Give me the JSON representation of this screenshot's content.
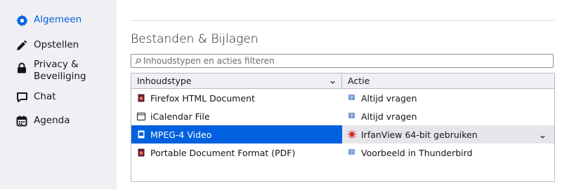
{
  "sidebar": {
    "items": [
      {
        "label": "Algemeen",
        "icon": "gear-icon"
      },
      {
        "label": "Opstellen",
        "icon": "pencil-icon"
      },
      {
        "label": "Privacy & Beveiliging",
        "icon": "lock-icon"
      },
      {
        "label": "Chat",
        "icon": "chat-icon"
      },
      {
        "label": "Agenda",
        "icon": "calendar-icon"
      }
    ]
  },
  "section": {
    "title": "Bestanden & Bijlagen",
    "search_placeholder": "Inhoudstypen en acties filteren"
  },
  "table": {
    "columns": {
      "type": "Inhoudstype",
      "action": "Actie"
    },
    "rows": [
      {
        "type": "Firefox HTML Document",
        "type_icon": "firefox-doc-icon",
        "action": "Altijd vragen",
        "action_icon": "ask-icon"
      },
      {
        "type": "iCalendar File",
        "type_icon": "calendar-file-icon",
        "action": "Altijd vragen",
        "action_icon": "ask-icon"
      },
      {
        "type": "MPEG-4 Video",
        "type_icon": "video-file-icon",
        "action": "IrfanView 64-bit gebruiken",
        "action_icon": "irfanview-icon",
        "selected": true
      },
      {
        "type": "Portable Document Format (PDF)",
        "type_icon": "pdf-icon",
        "action": "Voorbeeld in Thunderbird",
        "action_icon": "ask-icon"
      }
    ]
  },
  "colors": {
    "accent": "#0061e0",
    "sidebar_bg": "#f0f0f4",
    "selected_row_bg": "#0061e0"
  }
}
